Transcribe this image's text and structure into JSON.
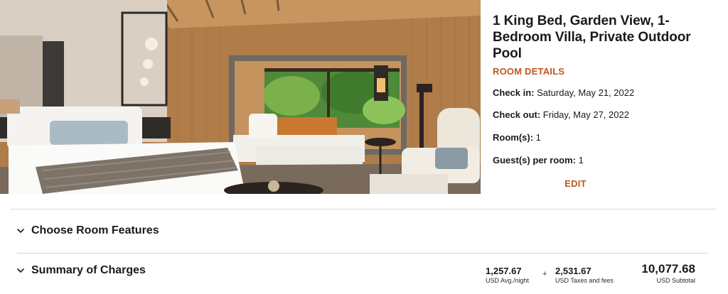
{
  "room": {
    "title": "1 King Bed, Garden View, 1-Bedroom Villa, Private Outdoor Pool",
    "details_link": "ROOM DETAILS",
    "image_alt": "Villa bedroom with king bed, daybed and garden window"
  },
  "stay": {
    "checkin_label": "Check in:",
    "checkin_value": "Saturday, May 21, 2022",
    "checkout_label": "Check out:",
    "checkout_value": "Friday, May 27, 2022",
    "rooms_label": "Room(s):",
    "rooms_value": "1",
    "guests_label": "Guest(s) per room:",
    "guests_value": "1",
    "edit_link": "EDIT"
  },
  "sections": {
    "features_title": "Choose Room Features",
    "charges_title": "Summary of Charges"
  },
  "charges": {
    "avg_value": "1,257.67",
    "avg_label": "USD Avg./night",
    "plus": "+",
    "tax_value": "2,531.67",
    "tax_label": "USD Taxes and fees",
    "subtotal_value": "10,077.68",
    "subtotal_label": "USD Subtotal"
  },
  "colors": {
    "accent": "#c0571f",
    "divider": "#d6d6d6",
    "text": "#1a1a1a"
  },
  "icons": {
    "section_toggle": "chevron-down-icon"
  }
}
